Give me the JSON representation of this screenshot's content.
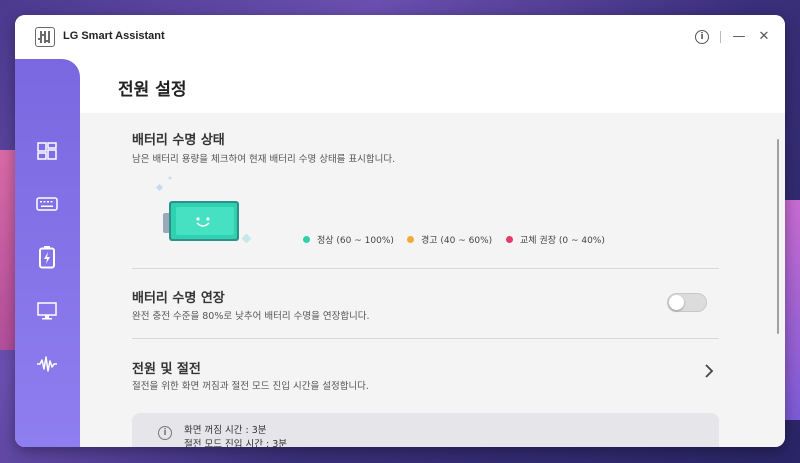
{
  "app": {
    "title": "LG Smart Assistant"
  },
  "titlebar": {
    "info_glyph": "i",
    "minimize_glyph": "—",
    "close_glyph": "✕"
  },
  "page": {
    "title": "전원 설정"
  },
  "sidebar": {
    "items": [
      {
        "name": "dashboard-icon"
      },
      {
        "name": "keyboard-icon"
      },
      {
        "name": "battery-icon",
        "active": true
      },
      {
        "name": "monitor-icon"
      },
      {
        "name": "audio-wave-icon"
      }
    ]
  },
  "battery_health": {
    "title": "배터리 수명 상태",
    "description": "남은 배터리 용량을 체크하여 현재 배터리 수명 상태를 표시합니다.",
    "legend": [
      {
        "label": "정상 (60 ~ 100%)",
        "color": "#2ed1a8"
      },
      {
        "label": "경고 (40 ~ 60%)",
        "color": "#f0a93a"
      },
      {
        "label": "교체 권장 (0 ~ 40%)",
        "color": "#e83a6a"
      }
    ]
  },
  "battery_extend": {
    "title": "배터리 수명 연장",
    "description": "완전 충전 수준을 80%로 낮추어 배터리 수명을 연장합니다.",
    "enabled": false
  },
  "power_sleep": {
    "title": "전원 및 절전",
    "description": "절전을 위한 화면 꺼짐과 절전 모드 진입 시간을 설정합니다.",
    "info_glyph": "i",
    "info_lines": [
      "화면 꺼짐 시간 : 3분",
      "절전 모드 진입 시간 : 3분"
    ]
  },
  "colors": {
    "accent": "#7a68e0",
    "battery_face": "#2ed1b0"
  }
}
